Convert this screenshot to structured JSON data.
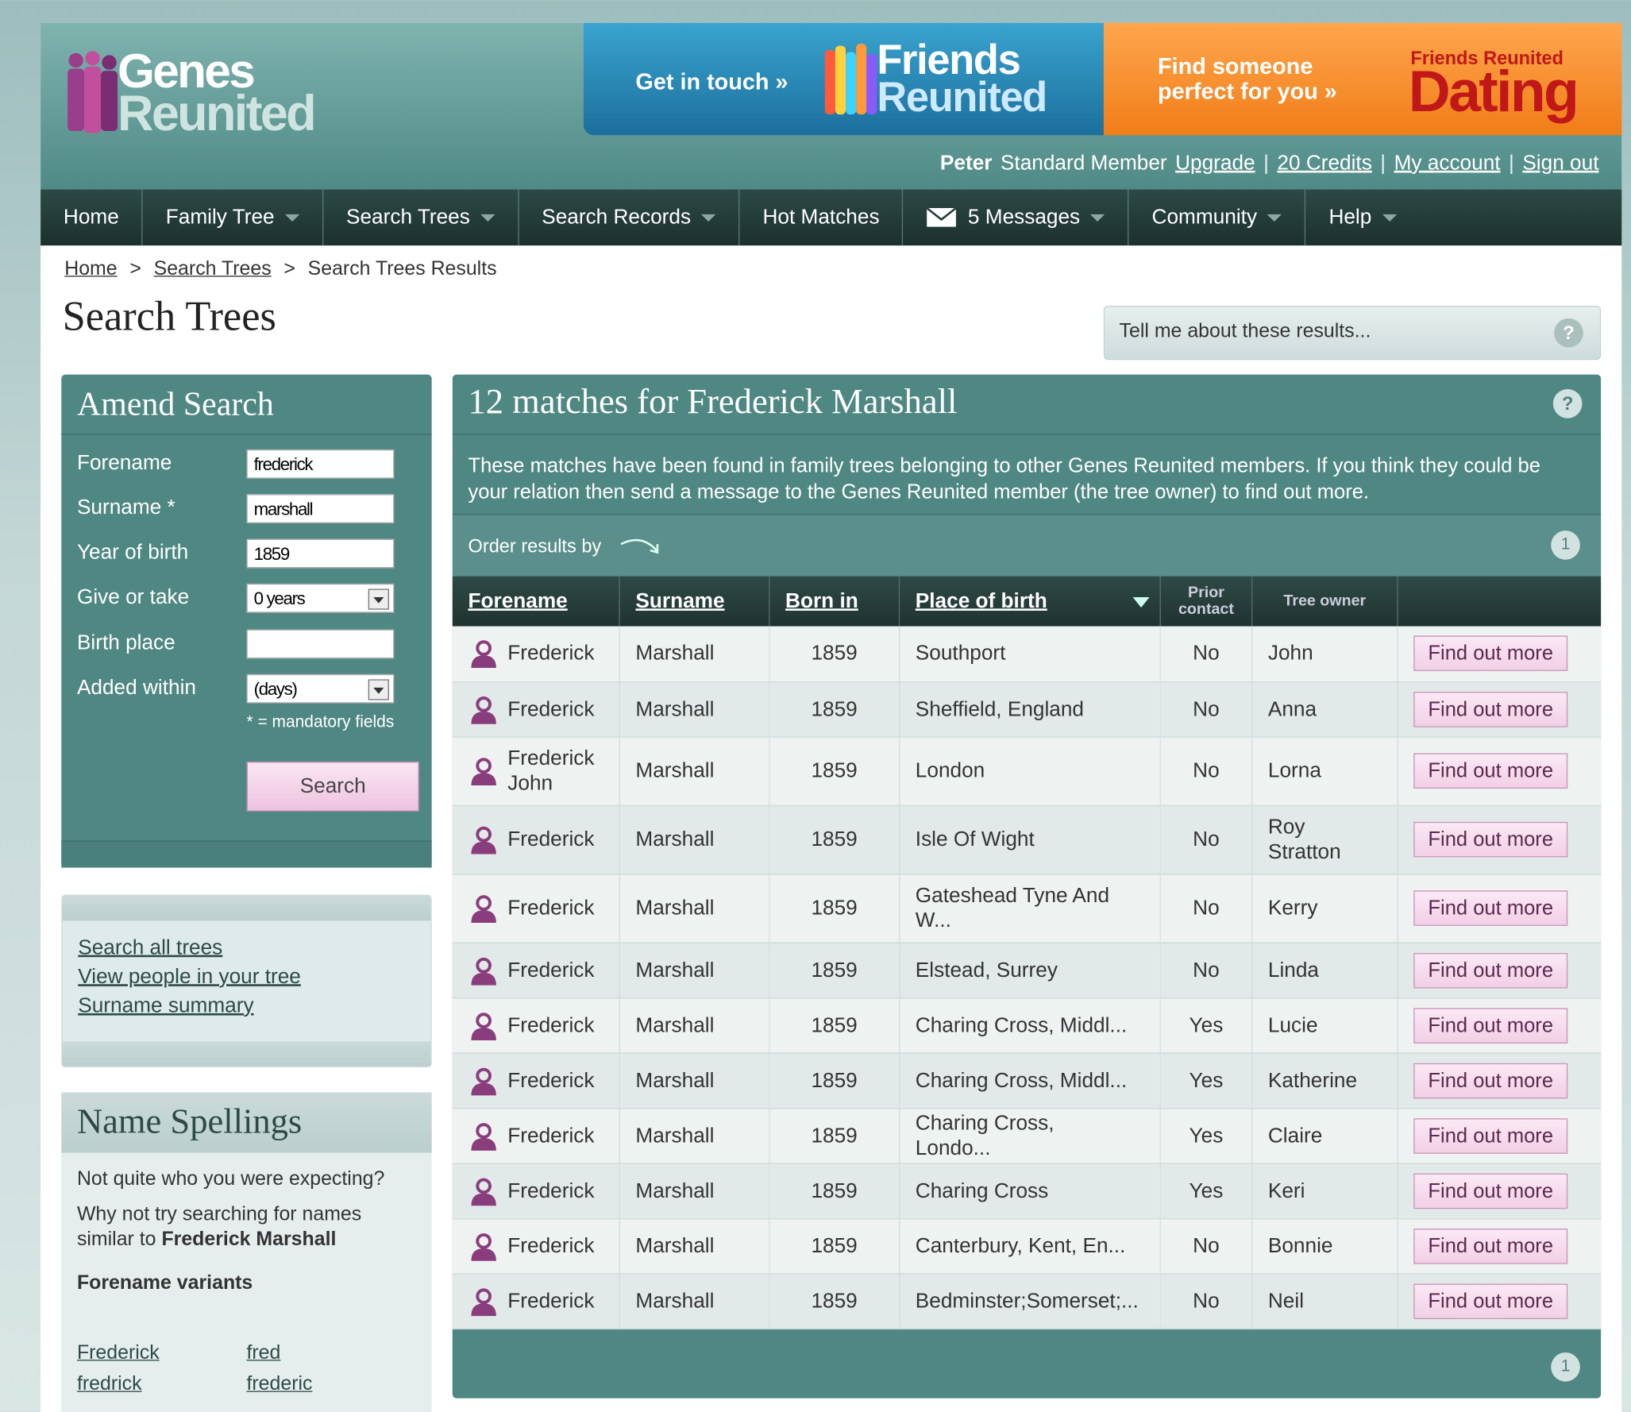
{
  "header": {
    "logo_line1": "Genes",
    "logo_line2": "Reunited",
    "friends_banner": {
      "cta": "Get in touch »",
      "brand1": "Friends",
      "brand2": "Reunited"
    },
    "dating_banner": {
      "cta": "Find someone perfect for you »",
      "brand_small": "Friends Reunited",
      "brand_big": "Dating"
    },
    "user": {
      "name": "Peter",
      "membership": "Standard Member",
      "upgrade": "Upgrade",
      "credits": "20 Credits",
      "account": "My account",
      "signout": "Sign out",
      "separator": "|"
    }
  },
  "nav": {
    "home": "Home",
    "family_tree": "Family Tree",
    "search_trees": "Search Trees",
    "search_records": "Search Records",
    "hot_matches": "Hot Matches",
    "messages": "5 Messages",
    "community": "Community",
    "help": "Help"
  },
  "breadcrumb": {
    "home": "Home",
    "search_trees": "Search Trees",
    "current": "Search Trees Results",
    "sep": ">"
  },
  "page_title": "Search Trees",
  "help_box": "Tell me about these results...",
  "amend": {
    "title": "Amend Search",
    "forename_label": "Forename",
    "forename_value": "frederick",
    "surname_label": "Surname *",
    "surname_value": "marshall",
    "yob_label": "Year of birth",
    "yob_value": "1859",
    "give_label": "Give or take",
    "give_value": "0 years",
    "birthplace_label": "Birth place",
    "birthplace_value": "",
    "added_label": "Added within",
    "added_value": "(days)",
    "mandatory_note": "* = mandatory fields",
    "search_button": "Search"
  },
  "links": {
    "search_all": "Search all trees",
    "view_people": "View people in your tree",
    "surname_summary": "Surname summary"
  },
  "name_spellings": {
    "title": "Name Spellings",
    "line1": "Not quite who you were expecting?",
    "line2": "Why not try searching for names similar to",
    "line2_name": "Frederick Marshall",
    "variants_title": "Forename variants",
    "variants": [
      "Frederick",
      "fred",
      "fredrick",
      "frederic"
    ]
  },
  "results": {
    "title": "12 matches for Frederick Marshall",
    "description": "These matches have been found in family trees belonging to other Genes Reunited members. If you think they could be your relation then send a message to the Genes Reunited member (the tree owner) to find out more.",
    "order_label": "Order results by",
    "page": "1",
    "columns": {
      "forename": "Forename",
      "surname": "Surname",
      "born": "Born in",
      "place": "Place of birth",
      "prior_contact": "Prior contact",
      "tree_owner": "Tree owner"
    },
    "rows": [
      {
        "forename": "Frederick",
        "surname": "Marshall",
        "born": "1859",
        "place": "Southport",
        "prior": "No",
        "owner": "John",
        "action": "Find out more"
      },
      {
        "forename": "Frederick",
        "surname": "Marshall",
        "born": "1859",
        "place": "Sheffield, England",
        "prior": "No",
        "owner": "Anna",
        "action": "Find out more"
      },
      {
        "forename": "Frederick John",
        "surname": "Marshall",
        "born": "1859",
        "place": "London",
        "prior": "No",
        "owner": "Lorna",
        "action": "Find out more"
      },
      {
        "forename": "Frederick",
        "surname": "Marshall",
        "born": "1859",
        "place": "Isle Of Wight",
        "prior": "No",
        "owner": "Roy Stratton",
        "action": "Find out more"
      },
      {
        "forename": "Frederick",
        "surname": "Marshall",
        "born": "1859",
        "place": "Gateshead Tyne And W...",
        "prior": "No",
        "owner": "Kerry",
        "action": "Find out more"
      },
      {
        "forename": "Frederick",
        "surname": "Marshall",
        "born": "1859",
        "place": "Elstead, Surrey",
        "prior": "No",
        "owner": "Linda",
        "action": "Find out more"
      },
      {
        "forename": "Frederick",
        "surname": "Marshall",
        "born": "1859",
        "place": "Charing Cross, Middl...",
        "prior": "Yes",
        "owner": "Lucie",
        "action": "Find out more"
      },
      {
        "forename": "Frederick",
        "surname": "Marshall",
        "born": "1859",
        "place": "Charing Cross, Middl...",
        "prior": "Yes",
        "owner": "Katherine",
        "action": "Find out more"
      },
      {
        "forename": "Frederick",
        "surname": "Marshall",
        "born": "1859",
        "place": "Charing Cross, Londo...",
        "prior": "Yes",
        "owner": "Claire",
        "action": "Find out more"
      },
      {
        "forename": "Frederick",
        "surname": "Marshall",
        "born": "1859",
        "place": "Charing Cross",
        "prior": "Yes",
        "owner": "Keri",
        "action": "Find out more"
      },
      {
        "forename": "Frederick",
        "surname": "Marshall",
        "born": "1859",
        "place": "Canterbury, Kent, En...",
        "prior": "No",
        "owner": "Bonnie",
        "action": "Find out more"
      },
      {
        "forename": "Frederick",
        "surname": "Marshall",
        "born": "1859",
        "place": "Bedminster;Somerset;...",
        "prior": "No",
        "owner": "Neil",
        "action": "Find out more"
      }
    ]
  },
  "colors": {
    "teal": "#4f8783",
    "nav": "#253d39",
    "accent_pink": "#f2cfe6",
    "orange": "#f07d18",
    "blue": "#1c6f9c"
  }
}
